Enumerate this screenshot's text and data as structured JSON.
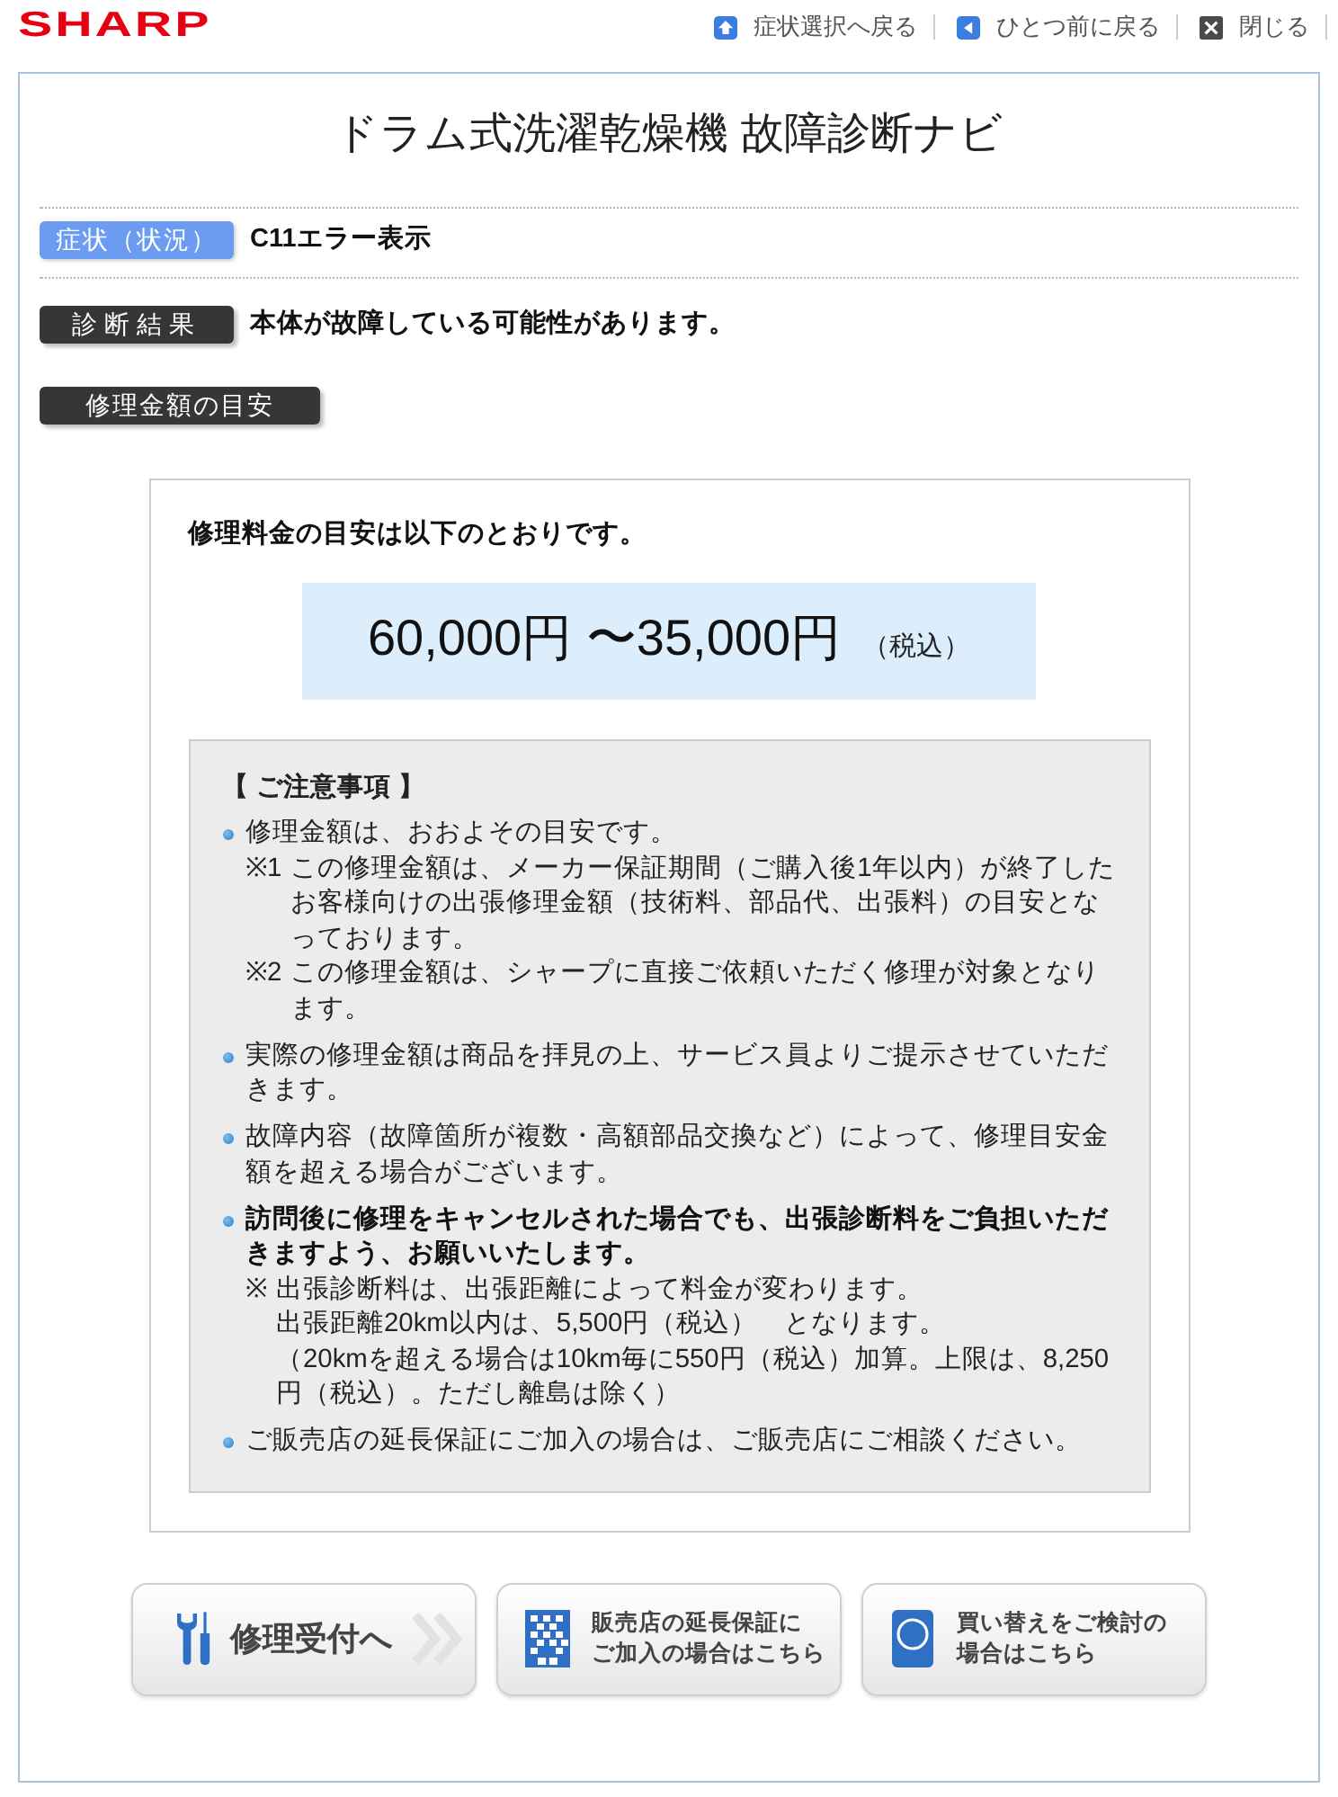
{
  "header": {
    "logo": "SHARP",
    "nav_links": [
      {
        "kind": "up",
        "label": "症状選択へ戻る"
      },
      {
        "kind": "back",
        "label": "ひとつ前に戻る"
      },
      {
        "kind": "close",
        "label": "閉じる"
      }
    ]
  },
  "title": "ドラム式洗濯乾燥機 故障診断ナビ",
  "result_rows": [
    {
      "kind": "symptom",
      "label": "症状（状況）",
      "value": "C11エラー表示"
    },
    {
      "kind": "diagnosis",
      "label": "診断結果",
      "value": "本体が故障している可能性があります。"
    }
  ],
  "estimate": {
    "label": "修理金額の目安",
    "intro": "修理料金の目安は以下のとおりです。",
    "price": "60,000円 〜35,000円",
    "tax_note": "（税込）"
  },
  "notice": {
    "heading": "【 ご注意事項 】",
    "items": [
      {
        "text": "修理金額は、おおよその目安です。",
        "bold": false,
        "notes": [
          {
            "mark": "※1",
            "lines": [
              "この修理金額は、メーカー保証期間（ご購入後1年以内）が終了したお客様向けの出張修理金額（技術料、部品代、出張料）の目安となっております。"
            ]
          },
          {
            "mark": "※2",
            "lines": [
              "この修理金額は、シャープに直接ご依頼いただく修理が対象となります。"
            ]
          }
        ]
      },
      {
        "text": "実際の修理金額は商品を拝見の上、サービス員よりご提示させていただきます。",
        "bold": false
      },
      {
        "text": "故障内容（故障箇所が複数・高額部品交換など）によって、修理目安金額を超える場合がございます。",
        "bold": false
      },
      {
        "text": "訪問後に修理をキャンセルされた場合でも、出張診断料をご負担いただきますよう、お願いいたします。",
        "bold": true,
        "notes": [
          {
            "mark": "※",
            "lines": [
              "出張診断料は、出張距離によって料金が変わります。",
              "出張距離20km以内は、5,500円（税込）　となります。",
              "（20kmを超える場合は10km毎に550円（税込）加算。上限は、8,250円（税込）。ただし離島は除く）"
            ]
          }
        ]
      },
      {
        "text": "ご販売店の延長保証にご加入の場合は、ご販売店にご相談ください。",
        "bold": false
      }
    ]
  },
  "buttons": [
    {
      "kind": "repair",
      "lines": [
        "修理受付へ"
      ]
    },
    {
      "kind": "warranty",
      "lines": [
        "販売店の延長保証に",
        "ご加入の場合はこちら"
      ]
    },
    {
      "kind": "replace",
      "lines": [
        "買い替えをご検討の",
        "場合はこちら"
      ]
    }
  ]
}
